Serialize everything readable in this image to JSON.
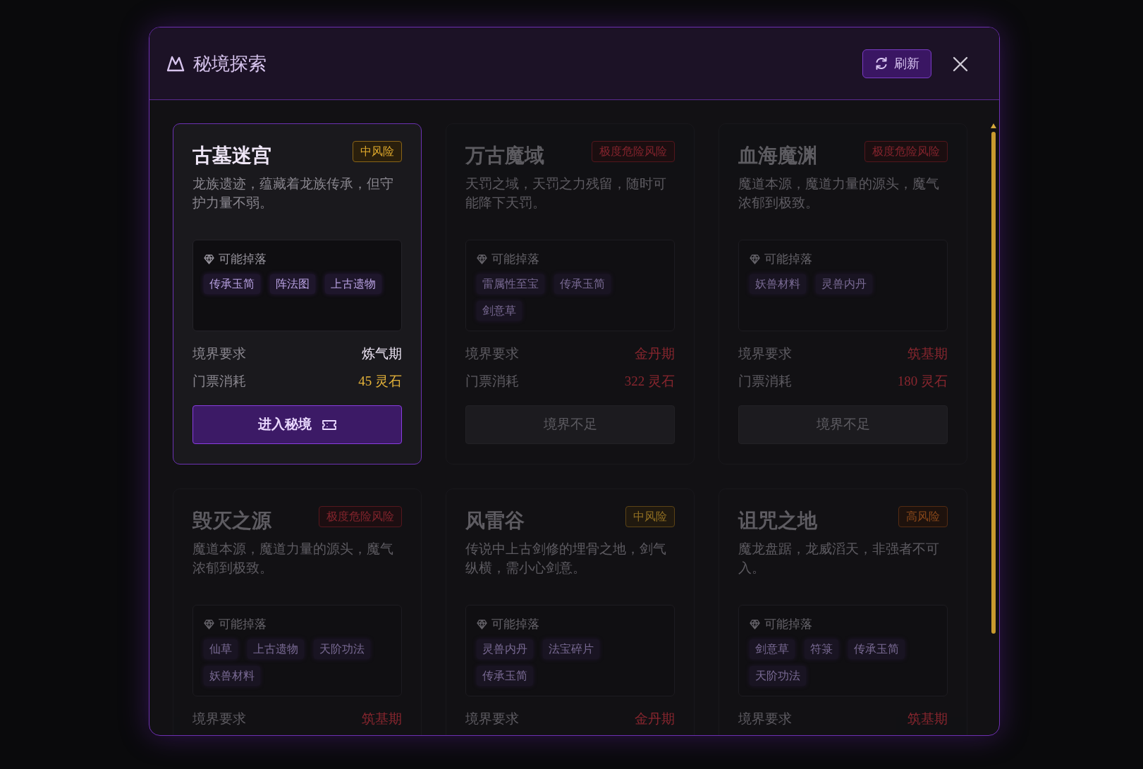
{
  "dialog": {
    "title": "秘境探索",
    "refresh_button": "刷新"
  },
  "realms": [
    {
      "name": "古墓迷宫",
      "risk": {
        "label": "中风险",
        "kind": "medium"
      },
      "available": true,
      "description": "龙族遗迹，蕴藏着龙族传承，但守护力量不弱。",
      "drops_label": "可能掉落",
      "drops": [
        "传承玉简",
        "阵法图",
        "上古遗物"
      ],
      "realm_label": "境界要求",
      "realm": "炼气期",
      "realm_met": true,
      "cost_label": "门票消耗",
      "cost": "45 灵石",
      "affordable": true,
      "button": {
        "label": "进入秘境",
        "kind": "enter"
      }
    },
    {
      "name": "万古魔域",
      "risk": {
        "label": "极度危险风险",
        "kind": "extreme"
      },
      "available": false,
      "description": "天罚之域，天罚之力残留，随时可能降下天罚。",
      "drops_label": "可能掉落",
      "drops": [
        "雷属性至宝",
        "传承玉简",
        "剑意草"
      ],
      "realm_label": "境界要求",
      "realm": "金丹期",
      "realm_met": false,
      "cost_label": "门票消耗",
      "cost": "322 灵石",
      "affordable": false,
      "button": {
        "label": "境界不足",
        "kind": "locked"
      }
    },
    {
      "name": "血海魔渊",
      "risk": {
        "label": "极度危险风险",
        "kind": "extreme"
      },
      "available": false,
      "description": "魔道本源，魔道力量的源头，魔气浓郁到极致。",
      "drops_label": "可能掉落",
      "drops": [
        "妖兽材料",
        "灵兽内丹"
      ],
      "realm_label": "境界要求",
      "realm": "筑基期",
      "realm_met": false,
      "cost_label": "门票消耗",
      "cost": "180 灵石",
      "affordable": false,
      "button": {
        "label": "境界不足",
        "kind": "locked"
      }
    },
    {
      "name": "毁灭之源",
      "risk": {
        "label": "极度危险风险",
        "kind": "extreme"
      },
      "available": false,
      "description": "魔道本源，魔道力量的源头，魔气浓郁到极致。",
      "drops_label": "可能掉落",
      "drops": [
        "仙草",
        "上古遗物",
        "天阶功法",
        "妖兽材料"
      ],
      "realm_label": "境界要求",
      "realm": "筑基期",
      "realm_met": false
    },
    {
      "name": "风雷谷",
      "risk": {
        "label": "中风险",
        "kind": "medium"
      },
      "available": false,
      "description": "传说中上古剑修的埋骨之地，剑气纵横，需小心剑意。",
      "drops_label": "可能掉落",
      "drops": [
        "灵兽内丹",
        "法宝碎片",
        "传承玉简"
      ],
      "realm_label": "境界要求",
      "realm": "金丹期",
      "realm_met": false
    },
    {
      "name": "诅咒之地",
      "risk": {
        "label": "高风险",
        "kind": "high"
      },
      "available": false,
      "description": "魔龙盘踞，龙威滔天，非强者不可入。",
      "drops_label": "可能掉落",
      "drops": [
        "剑意草",
        "符箓",
        "传承玉简",
        "天阶功法"
      ],
      "realm_label": "境界要求",
      "realm": "筑基期",
      "realm_met": false
    }
  ]
}
